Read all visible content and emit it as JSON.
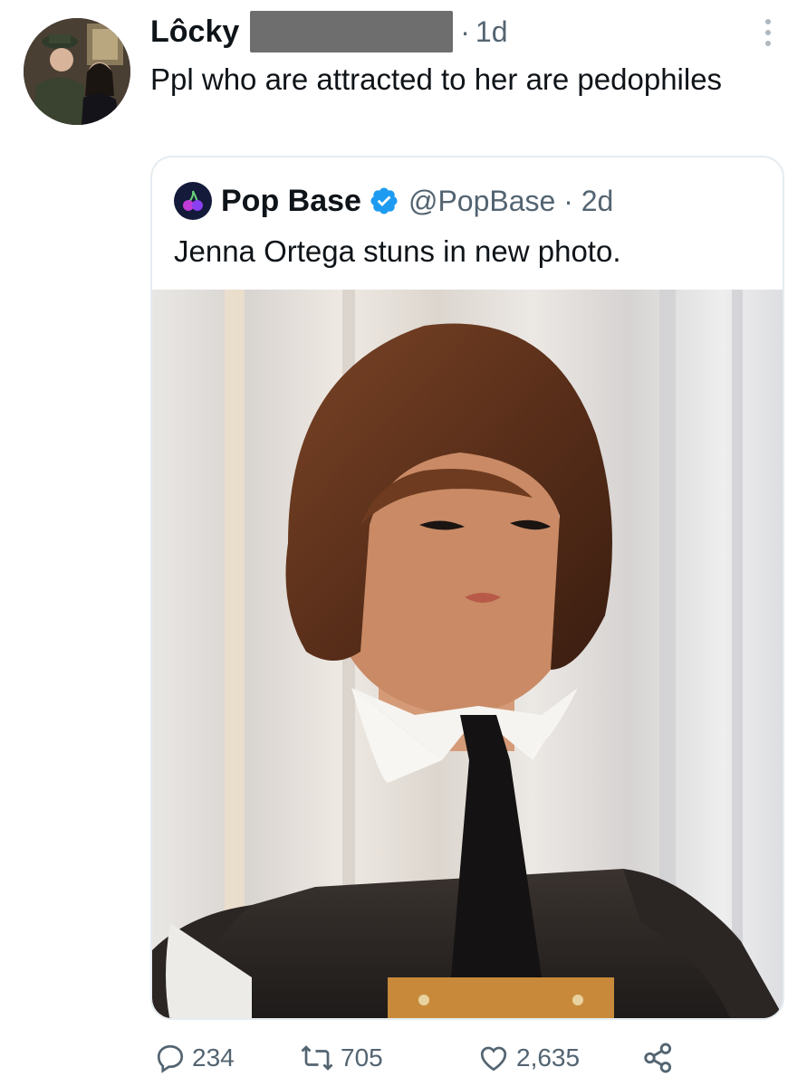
{
  "tweet": {
    "author_name": "Lôcky",
    "separator": "·",
    "timestamp": "1d",
    "text": "Ppl who are attracted to her are pedophiles"
  },
  "quoted_tweet": {
    "author_name": "Pop Base",
    "handle": "@PopBase · 2d",
    "text": "Jenna Ortega stuns in new photo."
  },
  "actions": {
    "replies": "234",
    "retweets": "705",
    "likes": "2,635"
  },
  "icons": {
    "reply": "speech-bubble-icon",
    "retweet": "retweet-arrows-icon",
    "like": "heart-icon",
    "share": "share-nodes-icon",
    "more": "vertical-ellipsis-icon",
    "verified": "verified-badge-icon"
  },
  "colors": {
    "verified_blue": "#1d9bf0",
    "secondary_text": "#536471",
    "primary_text": "#0f1419",
    "card_border": "#e6ecf0"
  }
}
